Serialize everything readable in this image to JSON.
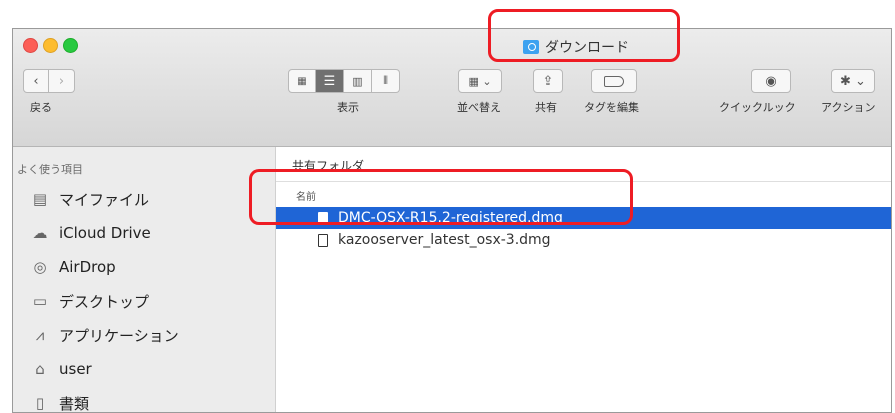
{
  "window": {
    "title": "ダウンロード",
    "title_icon": "folder-download-icon"
  },
  "toolbar": {
    "back_label": "戻る",
    "view_label": "表示",
    "sort_label": "並べ替え",
    "share_label": "共有",
    "tags_label": "タグを編集",
    "quicklook_label": "クイックルック",
    "action_label": "アクション"
  },
  "sidebar": {
    "heading": "よく使う項目",
    "items": [
      {
        "label": "マイファイル",
        "icon": "all-my-files-icon"
      },
      {
        "label": "iCloud Drive",
        "icon": "cloud-icon"
      },
      {
        "label": "AirDrop",
        "icon": "airdrop-icon"
      },
      {
        "label": "デスクトップ",
        "icon": "desktop-icon"
      },
      {
        "label": "アプリケーション",
        "icon": "applications-icon"
      },
      {
        "label": "user",
        "icon": "home-icon"
      },
      {
        "label": "書類",
        "icon": "documents-icon"
      }
    ]
  },
  "main": {
    "breadcrumb": "共有フォルダ",
    "column_name": "名前",
    "files": [
      {
        "name": "DMC-OSX-R15.2-registered.dmg",
        "selected": true
      },
      {
        "name": "kazooserver_latest_osx-3.dmg",
        "selected": false
      }
    ]
  },
  "colors": {
    "selection": "#1f65d6",
    "callout": "#ee1c24"
  }
}
